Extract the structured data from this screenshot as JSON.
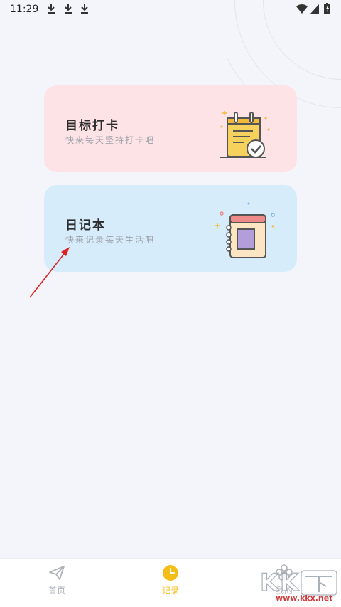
{
  "status_bar": {
    "time": "11:29"
  },
  "cards": [
    {
      "title": "目标打卡",
      "subtitle": "快来每天坚持打卡吧",
      "color": "#fde3e5",
      "icon": "clipboard-check-icon"
    },
    {
      "title": "日记本",
      "subtitle": "快来记录每天生活吧",
      "color": "#d6ecfb",
      "icon": "notebook-icon"
    }
  ],
  "tabs": [
    {
      "label": "首页",
      "icon": "paper-plane-icon",
      "active": false
    },
    {
      "label": "记录",
      "icon": "clock-icon",
      "active": true
    },
    {
      "label": "我的",
      "icon": "flower-icon",
      "active": false
    }
  ],
  "colors": {
    "active_tab": "#f5bd18",
    "inactive_tab": "#b0b3bb",
    "annotation_arrow": "#e02020"
  },
  "watermark": {
    "logo": "KK下载",
    "url": "www.kkx.net"
  }
}
